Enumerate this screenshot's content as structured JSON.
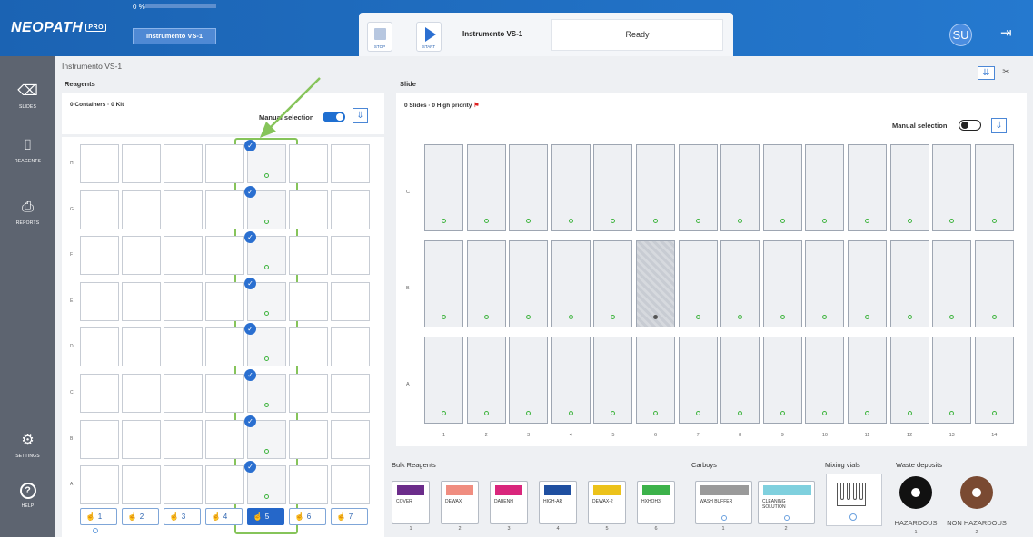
{
  "header": {
    "logo": "NEOPATH",
    "logo_badge": "PRO",
    "progress_text": "0 %",
    "progress_value": 0,
    "instrument_button": "Instrumento VS-1",
    "stop_label": "STOP",
    "start_label": "START",
    "instrument_name": "Instrumento VS-1",
    "status": "Ready",
    "avatar": "SU"
  },
  "sidebar": {
    "items": [
      {
        "label": "SLIDES",
        "icon": "eraser-icon"
      },
      {
        "label": "REAGENTS",
        "icon": "vial-icon"
      },
      {
        "label": "REPORTS",
        "icon": "printer-icon"
      },
      {
        "label": "SETTINGS",
        "icon": "gears-icon"
      },
      {
        "label": "HELP",
        "icon": "help-icon"
      }
    ]
  },
  "breadcrumb": "Instrumento VS-1",
  "reagents": {
    "title": "Reagents",
    "count": "0 Containers · 0 Kit",
    "manual_label": "Manual selection",
    "manual_on": true,
    "rows": [
      "H",
      "G",
      "F",
      "E",
      "D",
      "C",
      "B",
      "A"
    ],
    "selected_column": 5,
    "racks": [
      "1",
      "2",
      "3",
      "4",
      "5",
      "6",
      "7"
    ],
    "active_rack": "5"
  },
  "slide": {
    "title": "Slide",
    "count": "0 Slides · 0 High priority",
    "manual_label": "Manual selection",
    "manual_on": false,
    "rows": [
      "C",
      "B",
      "A"
    ],
    "columns": [
      "1",
      "2",
      "3",
      "4",
      "5",
      "6",
      "7",
      "8",
      "9",
      "10",
      "11",
      "12",
      "13",
      "14"
    ],
    "disabled_slot": "B6"
  },
  "bulk": {
    "title": "Bulk Reagents",
    "items": [
      {
        "name": "COVER",
        "color": "#6b2c8a",
        "num": "1"
      },
      {
        "name": "DEWAX",
        "color": "#f08d80",
        "num": "2"
      },
      {
        "name": "DABENH",
        "color": "#d9267c",
        "num": "3"
      },
      {
        "name": "HIGH-AR",
        "color": "#1f4fa0",
        "num": "4"
      },
      {
        "name": "DEWAX-2",
        "color": "#ecc21a",
        "num": "5"
      },
      {
        "name": "HXHOH3",
        "color": "#3cb24a",
        "num": "6"
      }
    ]
  },
  "carboys": {
    "title": "Carboys",
    "items": [
      {
        "name": "WASH BUFFER",
        "color": "#9a9a9a",
        "num": "1"
      },
      {
        "name": "CLEANING SOLUTION",
        "color": "#7fd0de",
        "num": "2"
      }
    ]
  },
  "mixing": {
    "title": "Mixing vials"
  },
  "waste": {
    "title": "Waste deposits",
    "items": [
      {
        "name": "HAZARDOUS",
        "color": "#111111",
        "num": "1"
      },
      {
        "name": "NON HAZARDOUS",
        "color": "#7a4a32",
        "num": "2"
      }
    ]
  }
}
